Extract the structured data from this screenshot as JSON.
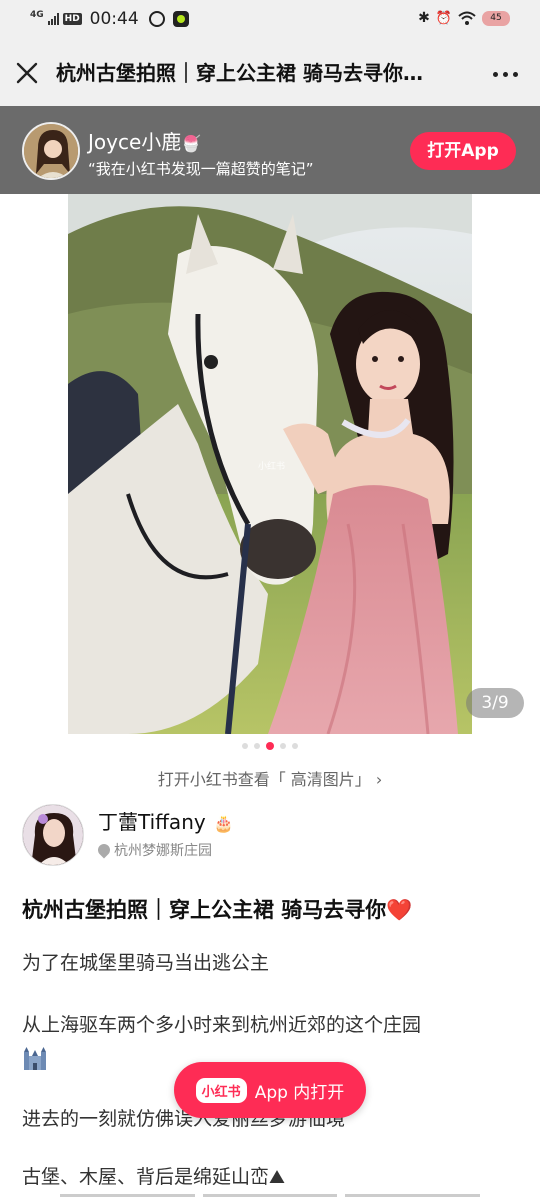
{
  "status_bar": {
    "network": "4G",
    "hd": "HD",
    "time": "00:44",
    "battery": "45"
  },
  "nav": {
    "title": "杭州古堡拍照｜穿上公主裙 骑马去寻你…",
    "close_icon": "close-icon",
    "more_icon": "more-icon"
  },
  "promo": {
    "name": "Joyce小鹿",
    "name_emoji": "🍧",
    "desc": "“我在小红书发现一篇超赞的笔记”",
    "button": "打开App"
  },
  "carousel": {
    "counter": "3/9",
    "total": 5,
    "active_index": 2,
    "hd_link": "打开小红书查看「 高清图片」 ›"
  },
  "author": {
    "name": "丁蕾Tiffany",
    "emoji": "🎂",
    "location": "杭州梦娜斯庄园"
  },
  "note": {
    "title": "杭州古堡拍照｜穿上公主裙 骑马去寻你",
    "title_emoji": "❤️",
    "paragraphs": [
      "为了在城堡里骑马当出逃公主",
      "从上海驱车两个多小时来到杭州近郊的这个庄园",
      "进去的一刻就仿佛误入爱丽丝梦游仙境",
      "古堡、木屋、背后是绵延山峦⛰"
    ]
  },
  "open_app": {
    "logo": "小红书",
    "label": "App 内打开"
  },
  "colors": {
    "accent": "#fe2c55",
    "banner": "#6b6b6b",
    "bar": "#f0f0f0"
  }
}
